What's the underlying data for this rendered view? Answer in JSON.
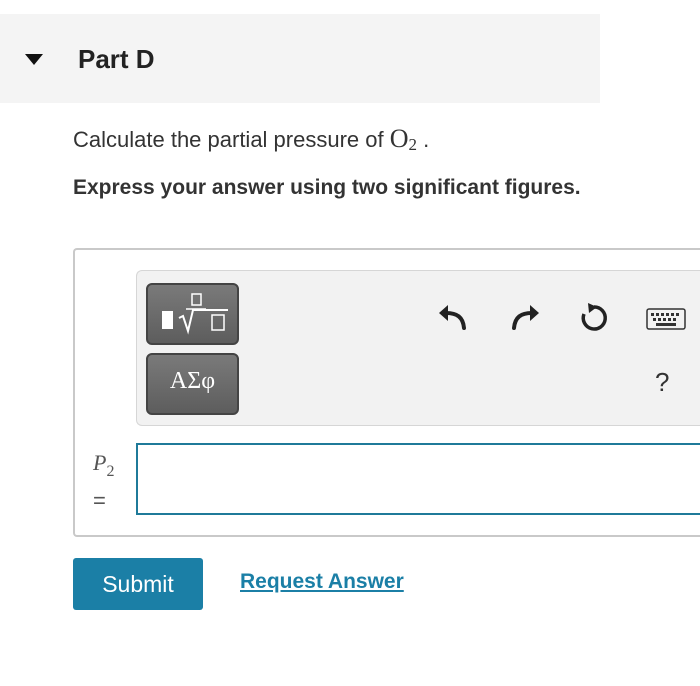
{
  "part": {
    "title": "Part D",
    "collapse_icon": "caret-down-icon"
  },
  "question": {
    "text": "Calculate the partial pressure of ",
    "chemical_base": "O",
    "chemical_subscript": "2",
    "suffix": " ."
  },
  "instruction": "Express your answer using two significant figures.",
  "toolbar": {
    "templates_icon": "fraction-radical-templates-icon",
    "greek_label": "ΑΣφ",
    "undo_icon": "undo-icon",
    "redo_icon": "redo-icon",
    "reset_icon": "reset-icon",
    "keyboard_icon": "keyboard-icon",
    "help_label": "?"
  },
  "answer": {
    "variable": "P",
    "variable_subscript": "2",
    "equals": "=",
    "value": "",
    "placeholder": ""
  },
  "actions": {
    "submit_label": "Submit",
    "request_label": "Request Answer"
  },
  "colors": {
    "accent": "#1b7fa6",
    "input_border": "#1f7a99",
    "header_bg": "#f4f4f4",
    "tool_button": "#6b6b6b"
  }
}
